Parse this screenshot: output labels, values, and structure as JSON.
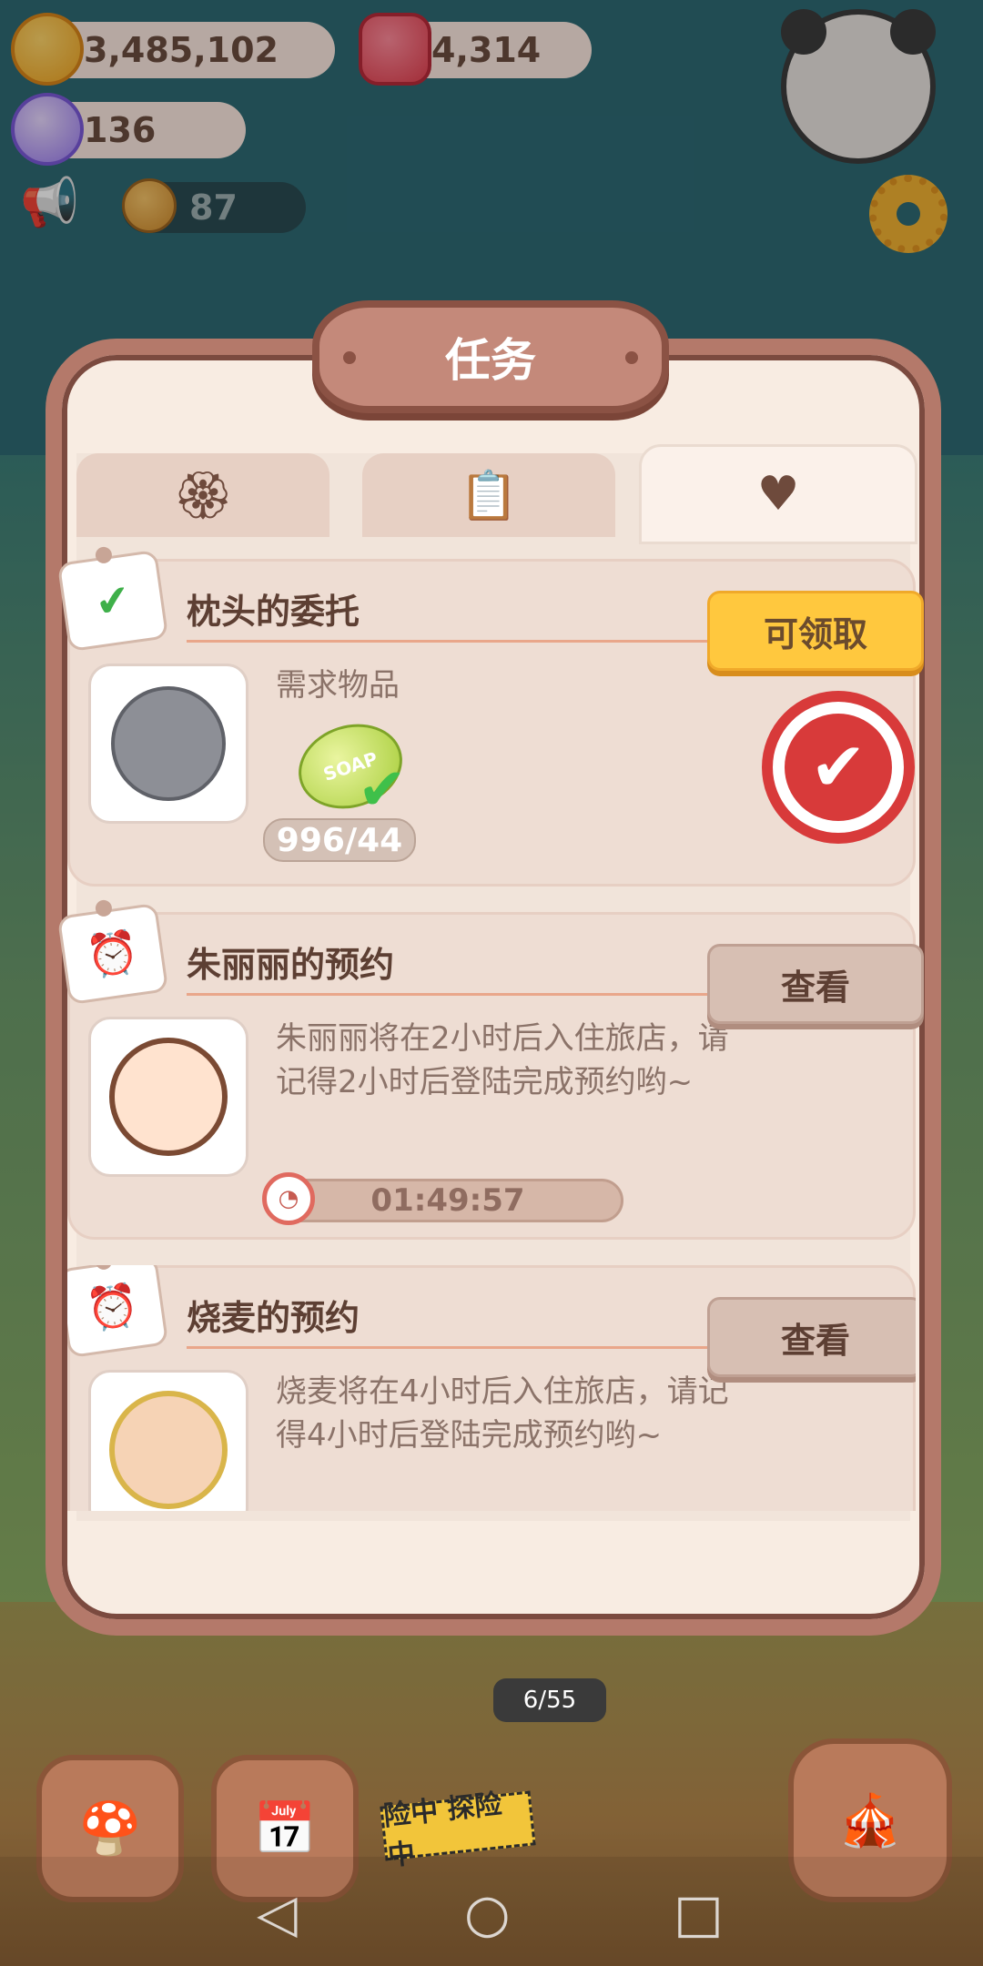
{
  "hud": {
    "coins": "3,485,102",
    "gems": "4,314",
    "candies": "136",
    "bread": "87"
  },
  "modal": {
    "title": "任务",
    "tabs": [
      {
        "icon": "paw-medal-icon",
        "active": false
      },
      {
        "icon": "clipboard-icon",
        "active": false
      },
      {
        "icon": "heart-bottle-icon",
        "active": true
      }
    ]
  },
  "tasks": [
    {
      "title": "枕头的委托",
      "tag_icon": "checklist-icon",
      "avatar": "koala-sleep-mask-avatar",
      "required_label": "需求物品",
      "item_icon": "soap-icon",
      "item_text": "SOAP",
      "count": "996/44",
      "button": "可领取",
      "stamp": "completed-stamp-icon"
    },
    {
      "title": "朱丽丽的预约",
      "tag_icon": "alarm-clock-icon",
      "avatar": "girl-buns-avatar",
      "description": "朱丽丽将在2小时后入住旅店，请记得2小时后登陆完成预约哟~",
      "timer": "01:49:57",
      "button": "查看"
    },
    {
      "title": "烧麦的预约",
      "tag_icon": "alarm-clock-icon",
      "avatar": "blond-guy-avatar",
      "description": "烧麦将在4小时后入住旅店，请记得4小时后登陆完成预约哟~",
      "button": "查看"
    }
  ],
  "game": {
    "progress": "6/55",
    "tape_text": "险中 探险中"
  }
}
